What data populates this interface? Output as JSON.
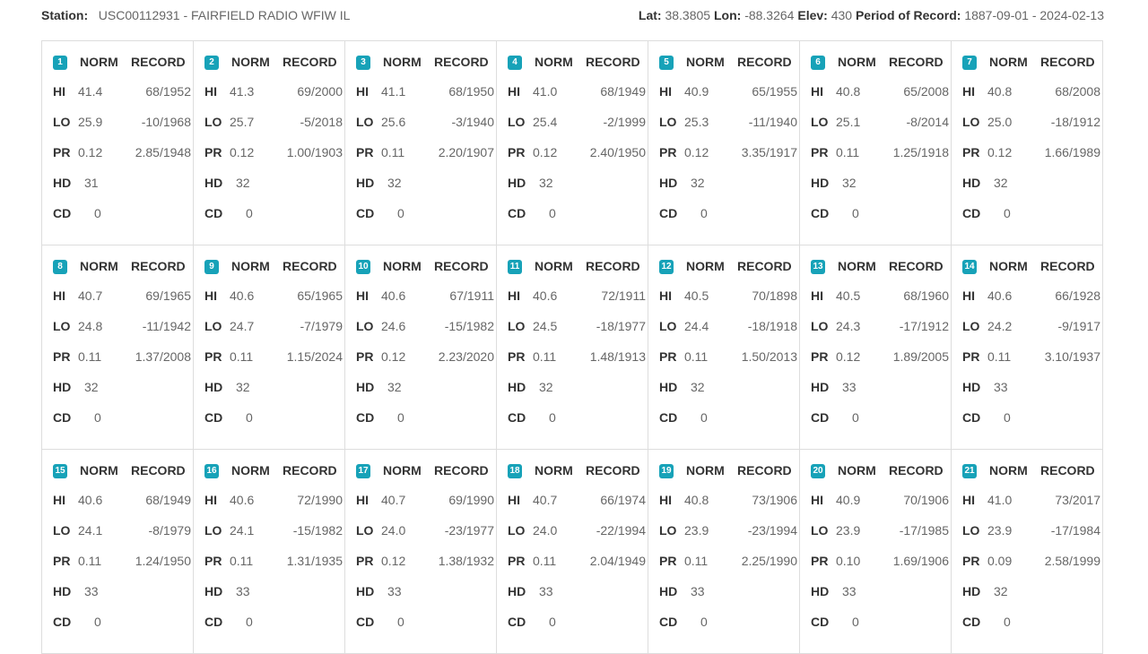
{
  "station": {
    "station_label": "Station:",
    "station_value": "USC00112931 - FAIRFIELD RADIO WFIW IL",
    "lat_label": "Lat:",
    "lat_value": "38.3805",
    "lon_label": "Lon:",
    "lon_value": "-88.3264",
    "elev_label": "Elev:",
    "elev_value": "430",
    "period_label": "Period of Record:",
    "period_value": "1887-09-01 - 2024-02-13"
  },
  "labels": {
    "norm": "NORM",
    "record": "RECORD",
    "hi": "HI",
    "lo": "LO",
    "pr": "PR",
    "hd": "HD",
    "cd": "CD"
  },
  "colors": {
    "badge": "#17a2b8",
    "border": "#dddddd"
  },
  "days": [
    {
      "day": "1",
      "hi": "41.4",
      "hi_rec": "68/1952",
      "lo": "25.9",
      "lo_rec": "-10/1968",
      "pr": "0.12",
      "pr_rec": "2.85/1948",
      "hd": "31",
      "cd": "0"
    },
    {
      "day": "2",
      "hi": "41.3",
      "hi_rec": "69/2000",
      "lo": "25.7",
      "lo_rec": "-5/2018",
      "pr": "0.12",
      "pr_rec": "1.00/1903",
      "hd": "32",
      "cd": "0"
    },
    {
      "day": "3",
      "hi": "41.1",
      "hi_rec": "68/1950",
      "lo": "25.6",
      "lo_rec": "-3/1940",
      "pr": "0.11",
      "pr_rec": "2.20/1907",
      "hd": "32",
      "cd": "0"
    },
    {
      "day": "4",
      "hi": "41.0",
      "hi_rec": "68/1949",
      "lo": "25.4",
      "lo_rec": "-2/1999",
      "pr": "0.12",
      "pr_rec": "2.40/1950",
      "hd": "32",
      "cd": "0"
    },
    {
      "day": "5",
      "hi": "40.9",
      "hi_rec": "65/1955",
      "lo": "25.3",
      "lo_rec": "-11/1940",
      "pr": "0.12",
      "pr_rec": "3.35/1917",
      "hd": "32",
      "cd": "0"
    },
    {
      "day": "6",
      "hi": "40.8",
      "hi_rec": "65/2008",
      "lo": "25.1",
      "lo_rec": "-8/2014",
      "pr": "0.11",
      "pr_rec": "1.25/1918",
      "hd": "32",
      "cd": "0"
    },
    {
      "day": "7",
      "hi": "40.8",
      "hi_rec": "68/2008",
      "lo": "25.0",
      "lo_rec": "-18/1912",
      "pr": "0.12",
      "pr_rec": "1.66/1989",
      "hd": "32",
      "cd": "0"
    },
    {
      "day": "8",
      "hi": "40.7",
      "hi_rec": "69/1965",
      "lo": "24.8",
      "lo_rec": "-11/1942",
      "pr": "0.11",
      "pr_rec": "1.37/2008",
      "hd": "32",
      "cd": "0"
    },
    {
      "day": "9",
      "hi": "40.6",
      "hi_rec": "65/1965",
      "lo": "24.7",
      "lo_rec": "-7/1979",
      "pr": "0.11",
      "pr_rec": "1.15/2024",
      "hd": "32",
      "cd": "0"
    },
    {
      "day": "10",
      "hi": "40.6",
      "hi_rec": "67/1911",
      "lo": "24.6",
      "lo_rec": "-15/1982",
      "pr": "0.12",
      "pr_rec": "2.23/2020",
      "hd": "32",
      "cd": "0"
    },
    {
      "day": "11",
      "hi": "40.6",
      "hi_rec": "72/1911",
      "lo": "24.5",
      "lo_rec": "-18/1977",
      "pr": "0.11",
      "pr_rec": "1.48/1913",
      "hd": "32",
      "cd": "0"
    },
    {
      "day": "12",
      "hi": "40.5",
      "hi_rec": "70/1898",
      "lo": "24.4",
      "lo_rec": "-18/1918",
      "pr": "0.11",
      "pr_rec": "1.50/2013",
      "hd": "32",
      "cd": "0"
    },
    {
      "day": "13",
      "hi": "40.5",
      "hi_rec": "68/1960",
      "lo": "24.3",
      "lo_rec": "-17/1912",
      "pr": "0.12",
      "pr_rec": "1.89/2005",
      "hd": "33",
      "cd": "0"
    },
    {
      "day": "14",
      "hi": "40.6",
      "hi_rec": "66/1928",
      "lo": "24.2",
      "lo_rec": "-9/1917",
      "pr": "0.11",
      "pr_rec": "3.10/1937",
      "hd": "33",
      "cd": "0"
    },
    {
      "day": "15",
      "hi": "40.6",
      "hi_rec": "68/1949",
      "lo": "24.1",
      "lo_rec": "-8/1979",
      "pr": "0.11",
      "pr_rec": "1.24/1950",
      "hd": "33",
      "cd": "0"
    },
    {
      "day": "16",
      "hi": "40.6",
      "hi_rec": "72/1990",
      "lo": "24.1",
      "lo_rec": "-15/1982",
      "pr": "0.11",
      "pr_rec": "1.31/1935",
      "hd": "33",
      "cd": "0"
    },
    {
      "day": "17",
      "hi": "40.7",
      "hi_rec": "69/1990",
      "lo": "24.0",
      "lo_rec": "-23/1977",
      "pr": "0.12",
      "pr_rec": "1.38/1932",
      "hd": "33",
      "cd": "0"
    },
    {
      "day": "18",
      "hi": "40.7",
      "hi_rec": "66/1974",
      "lo": "24.0",
      "lo_rec": "-22/1994",
      "pr": "0.11",
      "pr_rec": "2.04/1949",
      "hd": "33",
      "cd": "0"
    },
    {
      "day": "19",
      "hi": "40.8",
      "hi_rec": "73/1906",
      "lo": "23.9",
      "lo_rec": "-23/1994",
      "pr": "0.11",
      "pr_rec": "2.25/1990",
      "hd": "33",
      "cd": "0"
    },
    {
      "day": "20",
      "hi": "40.9",
      "hi_rec": "70/1906",
      "lo": "23.9",
      "lo_rec": "-17/1985",
      "pr": "0.10",
      "pr_rec": "1.69/1906",
      "hd": "33",
      "cd": "0"
    },
    {
      "day": "21",
      "hi": "41.0",
      "hi_rec": "73/2017",
      "lo": "23.9",
      "lo_rec": "-17/1984",
      "pr": "0.09",
      "pr_rec": "2.58/1999",
      "hd": "32",
      "cd": "0"
    }
  ]
}
